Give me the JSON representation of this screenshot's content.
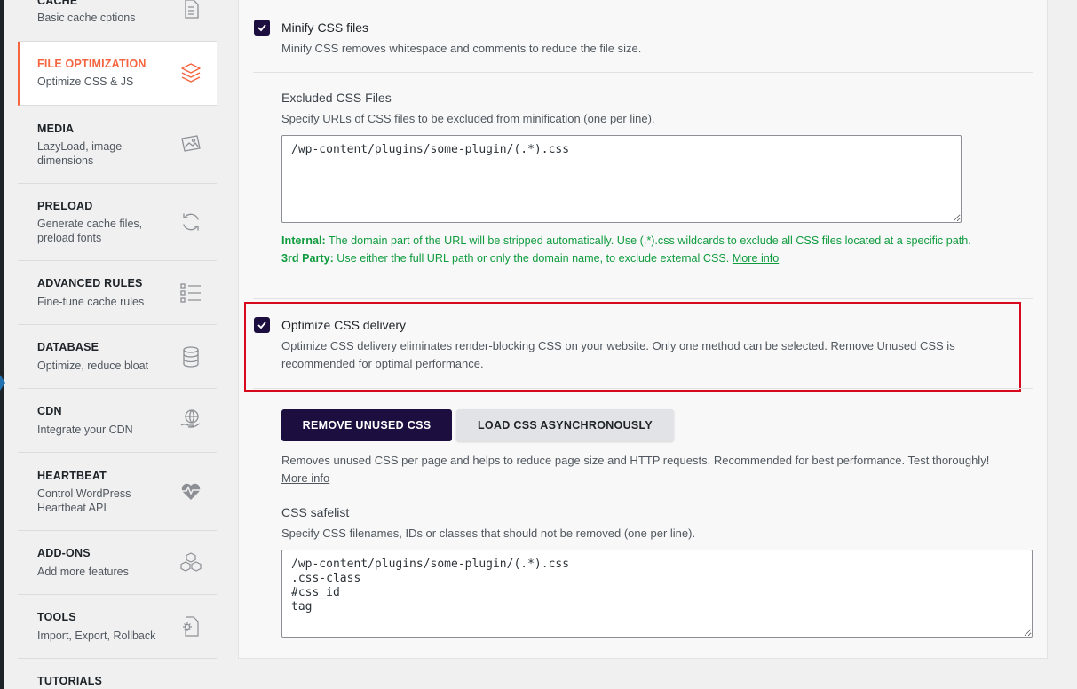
{
  "sidebar": {
    "items": [
      {
        "title": "CACHE",
        "desc": "Basic cache cptions",
        "icon": "document-icon"
      },
      {
        "title": "FILE OPTIMIZATION",
        "desc": "Optimize CSS & JS",
        "icon": "layers-icon"
      },
      {
        "title": "MEDIA",
        "desc": "LazyLoad, image dimensions",
        "icon": "images-icon"
      },
      {
        "title": "PRELOAD",
        "desc": "Generate cache files, preload fonts",
        "icon": "refresh-icon"
      },
      {
        "title": "ADVANCED RULES",
        "desc": "Fine-tune cache rules",
        "icon": "list-icon"
      },
      {
        "title": "DATABASE",
        "desc": "Optimize, reduce bloat",
        "icon": "database-icon"
      },
      {
        "title": "CDN",
        "desc": "Integrate your CDN",
        "icon": "globe-hand-icon"
      },
      {
        "title": "HEARTBEAT",
        "desc": "Control WordPress Heartbeat API",
        "icon": "heartbeat-icon"
      },
      {
        "title": "ADD-ONS",
        "desc": "Add more features",
        "icon": "cubes-icon"
      },
      {
        "title": "TOOLS",
        "desc": "Import, Export, Rollback",
        "icon": "gear-document-icon"
      },
      {
        "title": "TUTORIALS",
        "desc": "",
        "icon": ""
      }
    ]
  },
  "minify": {
    "title": "Minify CSS files",
    "desc": "Minify CSS removes whitespace and comments to reduce the file size.",
    "checked": true
  },
  "excluded": {
    "title": "Excluded CSS Files",
    "desc": "Specify URLs of CSS files to be excluded from minification (one per line).",
    "value": "/wp-content/plugins/some-plugin/(.*).css",
    "note_internal_label": "Internal:",
    "note_internal_text": " The domain part of the URL will be stripped automatically. Use (.*).css wildcards to exclude all CSS files located at a specific path.",
    "note_third_label": "3rd Party:",
    "note_third_text": " Use either the full URL path or only the domain name, to exclude external CSS. ",
    "note_more": "More info"
  },
  "optimize_delivery": {
    "title": "Optimize CSS delivery",
    "desc": "Optimize CSS delivery eliminates render-blocking CSS on your website. Only one method can be selected. Remove Unused CSS is recommended for optimal performance.",
    "checked": true
  },
  "method_buttons": {
    "remove": "REMOVE UNUSED CSS",
    "async": "LOAD CSS ASYNCHRONOUSLY"
  },
  "remove_desc": "Removes unused CSS per page and helps to reduce page size and HTTP requests. Recommended for best performance. Test thoroughly!",
  "remove_more": "More info",
  "safelist": {
    "title": "CSS safelist",
    "desc": "Specify CSS filenames, IDs or classes that should not be removed (one per line).",
    "value": "/wp-content/plugins/some-plugin/(.*).css\n.css-class\n#css_id\ntag"
  },
  "colors": {
    "accent": "#f56640",
    "primary_dark": "#1c0f3f",
    "success_text": "#0f9b3e",
    "highlight_border": "#d60a1c"
  }
}
